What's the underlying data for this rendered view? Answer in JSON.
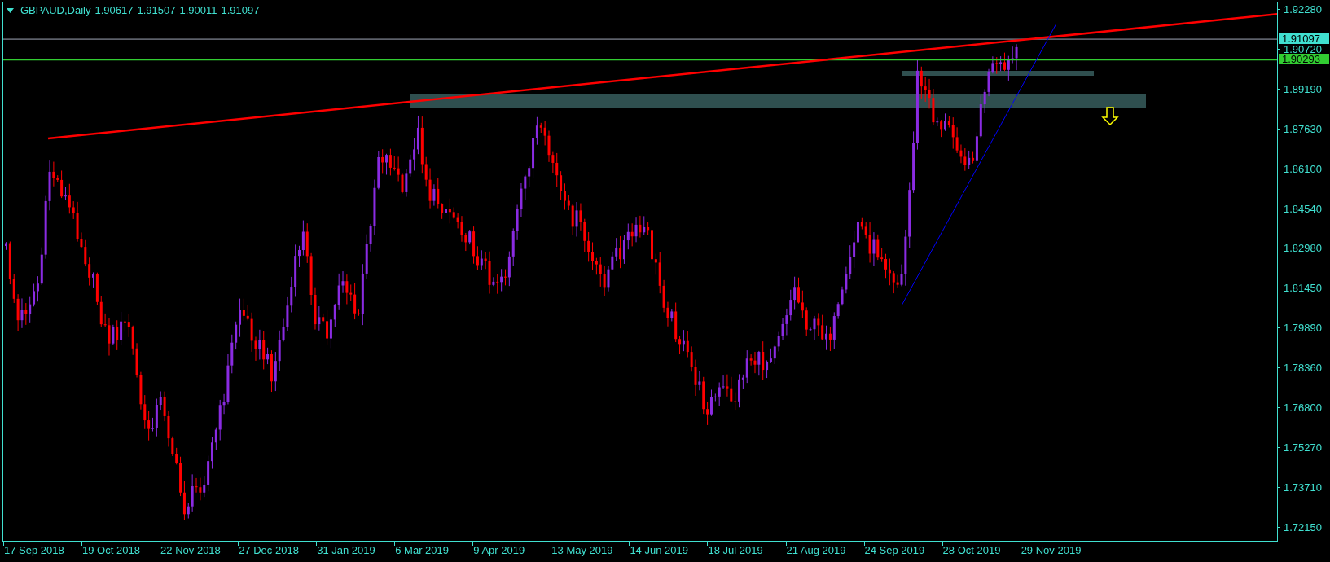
{
  "header": {
    "symbol": "GBPAUD,Daily",
    "ohlc": [
      "1.90617",
      "1.91507",
      "1.90011",
      "1.91097"
    ]
  },
  "price_axis": {
    "labels": [
      "1.92280",
      "1.90720",
      "1.89190",
      "1.87630",
      "1.86100",
      "1.84540",
      "1.82980",
      "1.81450",
      "1.79890",
      "1.78360",
      "1.76800",
      "1.75270",
      "1.73710",
      "1.72150"
    ]
  },
  "price_markers": [
    {
      "kind": "bid",
      "label": "1.91097",
      "color": "#40e0d0"
    },
    {
      "kind": "line",
      "label": "1.90293",
      "color": "#32cd32"
    }
  ],
  "time_axis": {
    "labels": [
      "17 Sep 2018",
      "19 Oct 2018",
      "22 Nov 2018",
      "27 Dec 2018",
      "31 Jan 2019",
      "6 Mar 2019",
      "9 Apr 2019",
      "13 May 2019",
      "14 Jun 2019",
      "18 Jul 2019",
      "21 Aug 2019",
      "24 Sep 2019",
      "28 Oct 2019",
      "29 Nov 2019"
    ]
  }
}
